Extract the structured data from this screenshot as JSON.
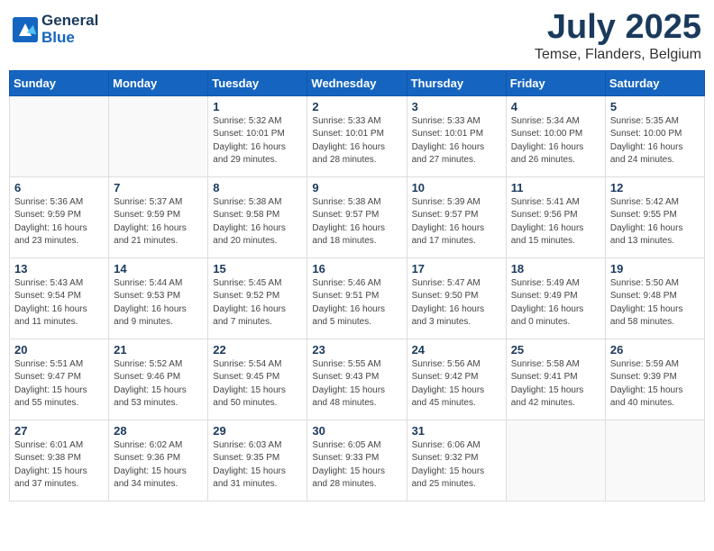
{
  "logo": {
    "line1": "General",
    "line2": "Blue"
  },
  "title": "July 2025",
  "location": "Temse, Flanders, Belgium",
  "days_header": [
    "Sunday",
    "Monday",
    "Tuesday",
    "Wednesday",
    "Thursday",
    "Friday",
    "Saturday"
  ],
  "weeks": [
    [
      {
        "day": "",
        "info": ""
      },
      {
        "day": "",
        "info": ""
      },
      {
        "day": "1",
        "info": "Sunrise: 5:32 AM\nSunset: 10:01 PM\nDaylight: 16 hours\nand 29 minutes."
      },
      {
        "day": "2",
        "info": "Sunrise: 5:33 AM\nSunset: 10:01 PM\nDaylight: 16 hours\nand 28 minutes."
      },
      {
        "day": "3",
        "info": "Sunrise: 5:33 AM\nSunset: 10:01 PM\nDaylight: 16 hours\nand 27 minutes."
      },
      {
        "day": "4",
        "info": "Sunrise: 5:34 AM\nSunset: 10:00 PM\nDaylight: 16 hours\nand 26 minutes."
      },
      {
        "day": "5",
        "info": "Sunrise: 5:35 AM\nSunset: 10:00 PM\nDaylight: 16 hours\nand 24 minutes."
      }
    ],
    [
      {
        "day": "6",
        "info": "Sunrise: 5:36 AM\nSunset: 9:59 PM\nDaylight: 16 hours\nand 23 minutes."
      },
      {
        "day": "7",
        "info": "Sunrise: 5:37 AM\nSunset: 9:59 PM\nDaylight: 16 hours\nand 21 minutes."
      },
      {
        "day": "8",
        "info": "Sunrise: 5:38 AM\nSunset: 9:58 PM\nDaylight: 16 hours\nand 20 minutes."
      },
      {
        "day": "9",
        "info": "Sunrise: 5:38 AM\nSunset: 9:57 PM\nDaylight: 16 hours\nand 18 minutes."
      },
      {
        "day": "10",
        "info": "Sunrise: 5:39 AM\nSunset: 9:57 PM\nDaylight: 16 hours\nand 17 minutes."
      },
      {
        "day": "11",
        "info": "Sunrise: 5:41 AM\nSunset: 9:56 PM\nDaylight: 16 hours\nand 15 minutes."
      },
      {
        "day": "12",
        "info": "Sunrise: 5:42 AM\nSunset: 9:55 PM\nDaylight: 16 hours\nand 13 minutes."
      }
    ],
    [
      {
        "day": "13",
        "info": "Sunrise: 5:43 AM\nSunset: 9:54 PM\nDaylight: 16 hours\nand 11 minutes."
      },
      {
        "day": "14",
        "info": "Sunrise: 5:44 AM\nSunset: 9:53 PM\nDaylight: 16 hours\nand 9 minutes."
      },
      {
        "day": "15",
        "info": "Sunrise: 5:45 AM\nSunset: 9:52 PM\nDaylight: 16 hours\nand 7 minutes."
      },
      {
        "day": "16",
        "info": "Sunrise: 5:46 AM\nSunset: 9:51 PM\nDaylight: 16 hours\nand 5 minutes."
      },
      {
        "day": "17",
        "info": "Sunrise: 5:47 AM\nSunset: 9:50 PM\nDaylight: 16 hours\nand 3 minutes."
      },
      {
        "day": "18",
        "info": "Sunrise: 5:49 AM\nSunset: 9:49 PM\nDaylight: 16 hours\nand 0 minutes."
      },
      {
        "day": "19",
        "info": "Sunrise: 5:50 AM\nSunset: 9:48 PM\nDaylight: 15 hours\nand 58 minutes."
      }
    ],
    [
      {
        "day": "20",
        "info": "Sunrise: 5:51 AM\nSunset: 9:47 PM\nDaylight: 15 hours\nand 55 minutes."
      },
      {
        "day": "21",
        "info": "Sunrise: 5:52 AM\nSunset: 9:46 PM\nDaylight: 15 hours\nand 53 minutes."
      },
      {
        "day": "22",
        "info": "Sunrise: 5:54 AM\nSunset: 9:45 PM\nDaylight: 15 hours\nand 50 minutes."
      },
      {
        "day": "23",
        "info": "Sunrise: 5:55 AM\nSunset: 9:43 PM\nDaylight: 15 hours\nand 48 minutes."
      },
      {
        "day": "24",
        "info": "Sunrise: 5:56 AM\nSunset: 9:42 PM\nDaylight: 15 hours\nand 45 minutes."
      },
      {
        "day": "25",
        "info": "Sunrise: 5:58 AM\nSunset: 9:41 PM\nDaylight: 15 hours\nand 42 minutes."
      },
      {
        "day": "26",
        "info": "Sunrise: 5:59 AM\nSunset: 9:39 PM\nDaylight: 15 hours\nand 40 minutes."
      }
    ],
    [
      {
        "day": "27",
        "info": "Sunrise: 6:01 AM\nSunset: 9:38 PM\nDaylight: 15 hours\nand 37 minutes."
      },
      {
        "day": "28",
        "info": "Sunrise: 6:02 AM\nSunset: 9:36 PM\nDaylight: 15 hours\nand 34 minutes."
      },
      {
        "day": "29",
        "info": "Sunrise: 6:03 AM\nSunset: 9:35 PM\nDaylight: 15 hours\nand 31 minutes."
      },
      {
        "day": "30",
        "info": "Sunrise: 6:05 AM\nSunset: 9:33 PM\nDaylight: 15 hours\nand 28 minutes."
      },
      {
        "day": "31",
        "info": "Sunrise: 6:06 AM\nSunset: 9:32 PM\nDaylight: 15 hours\nand 25 minutes."
      },
      {
        "day": "",
        "info": ""
      },
      {
        "day": "",
        "info": ""
      }
    ]
  ]
}
